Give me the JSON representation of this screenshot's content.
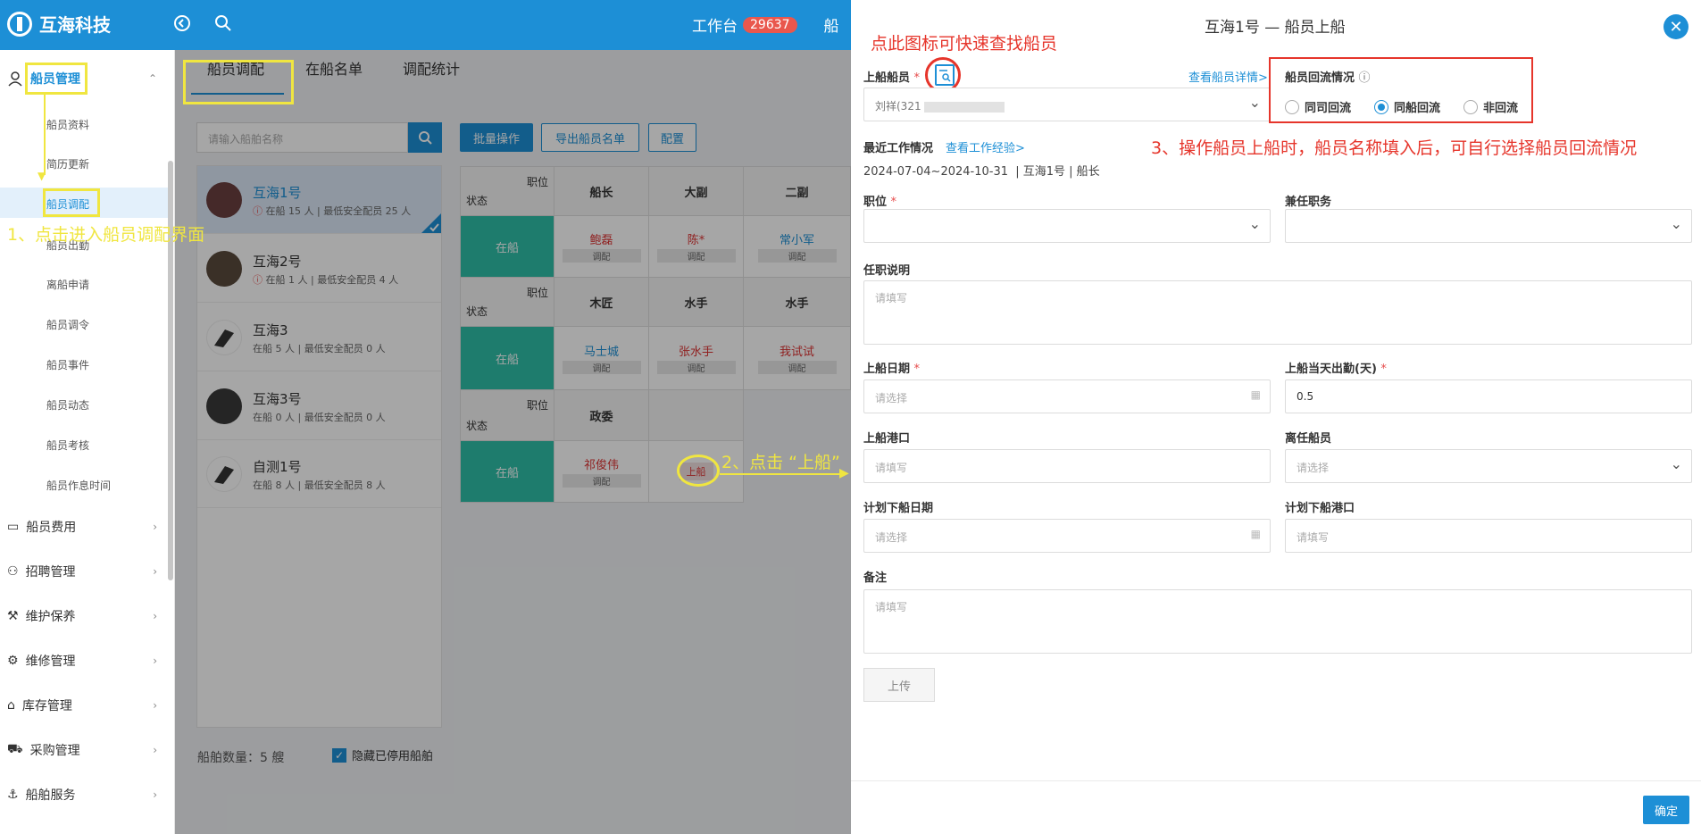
{
  "app": {
    "name": "互海科技",
    "workbench_label": "工作台",
    "workbench_count": "29637",
    "partial_menu": "船"
  },
  "sidebar": {
    "group_crew": "船员管理",
    "items": [
      "船员资料",
      "简历更新",
      "船员调配",
      "船员出勤",
      "离船申请",
      "船员调令",
      "船员事件",
      "船员动态",
      "船员考核",
      "船员作息时间"
    ],
    "groups": [
      "船员费用",
      "招聘管理",
      "维护保养",
      "维修管理",
      "库存管理",
      "采购管理",
      "船舶服务"
    ]
  },
  "main": {
    "tabs": [
      "船员调配",
      "在船名单",
      "调配统计"
    ],
    "search_placeholder": "请输入船舶名称",
    "buttons": {
      "batch": "批量操作",
      "export": "导出船员名单",
      "config": "配置"
    },
    "ships": [
      {
        "name": "互海1号",
        "info": "在船 15 人 | 最低安全配员 25 人",
        "warn": true
      },
      {
        "name": "互海2号",
        "info": "在船 1 人 | 最低安全配员 4 人",
        "warn": true
      },
      {
        "name": "互海3",
        "info": "在船 5 人 | 最低安全配员 0 人",
        "warn": false
      },
      {
        "name": "互海3号",
        "info": "在船 0 人 | 最低安全配员 0 人",
        "warn": false
      },
      {
        "name": "自测1号",
        "info": "在船 8 人 | 最低安全配员 8 人",
        "warn": false
      }
    ],
    "ship_count": "船舶数量：5 艘",
    "hide_label": "隐藏已停用船舶",
    "grid": {
      "pos_label": "职位",
      "status_label": "状态",
      "onboard": "在船",
      "adjust": "调配",
      "board_btn": "上船",
      "row1_positions": [
        "船长",
        "大副",
        "二副"
      ],
      "row1_crew": [
        "鲍磊",
        "陈*",
        "常小军"
      ],
      "row2_positions": [
        "木匠",
        "水手",
        "水手"
      ],
      "row2_crew": [
        "马士城",
        "张水手",
        "我试试"
      ],
      "row3_positions": [
        "政委"
      ],
      "row3_crew": [
        "祁俊伟"
      ]
    }
  },
  "drawer": {
    "title": "互海1号 — 船员上船",
    "crew_label": "上船船员",
    "crew_value": "刘祥(321",
    "view_detail": "查看船员详情>",
    "backflow_label": "船员回流情况",
    "backflow_options": [
      "同司回流",
      "同船回流",
      "非回流"
    ],
    "backflow_selected": 1,
    "recent_label": "最近工作情况",
    "view_exp": "查看工作经验>",
    "recent_value": "2024-07-04~2024-10-31  | 互海1号 | 船长",
    "position_label": "职位",
    "concurrent_label": "兼任职务",
    "duty_label": "任职说明",
    "placeholder_fill": "请填写",
    "placeholder_select": "请选择",
    "board_date_label": "上船日期",
    "board_attend_label": "上船当天出勤(天)",
    "board_attend_value": "0.5",
    "board_port_label": "上船港口",
    "leave_crew_label": "离任船员",
    "plan_date_label": "计划下船日期",
    "plan_port_label": "计划下船港口",
    "remark_label": "备注",
    "upload": "上传",
    "confirm": "确定"
  },
  "annotations": {
    "a1": "1、点击进入船员调配界面",
    "a2": "2、点击 “上船”",
    "a3": "3、操作船员上船时，船员名称填入后，可自行选择船员回流情况",
    "a4": "点此图标可快速查找船员"
  },
  "colors": {
    "primary": "#1d8fd6",
    "status_green": "#2fbfa8",
    "annotation_yellow": "#f0e640",
    "annotation_red": "#e6352b"
  }
}
